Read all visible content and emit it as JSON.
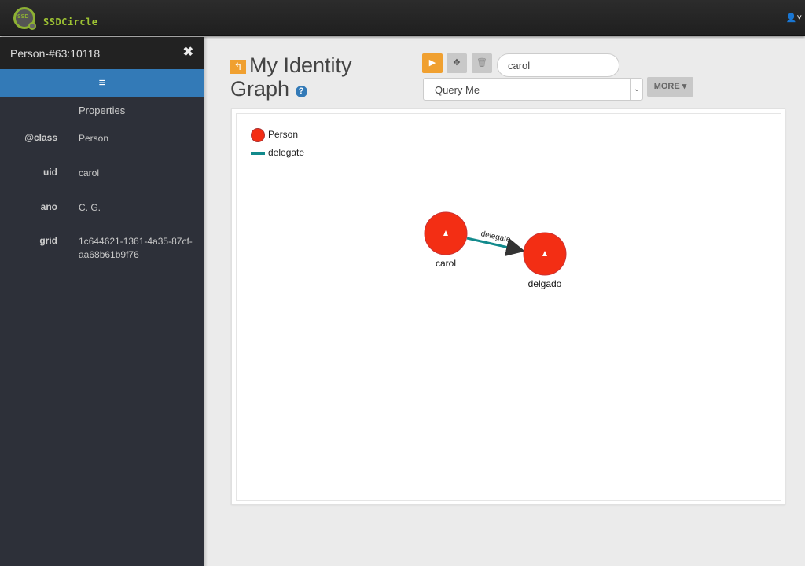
{
  "app": {
    "brand": "SSDCircle",
    "logo_text": "SSD",
    "user_icon": "user-icon"
  },
  "sidebar": {
    "title": "Person-#63:10118",
    "close_glyph": "✖",
    "toggle_glyph": "≡",
    "properties_title": "Properties",
    "properties": [
      {
        "key": "@class",
        "value": "Person"
      },
      {
        "key": "uid",
        "value": "carol"
      },
      {
        "key": "ano",
        "value": "C. G."
      },
      {
        "key": "grid",
        "value": "1c644621-1361-4a35-87cf-aa68b61b9f76"
      }
    ]
  },
  "header": {
    "title": "My Identity Graph",
    "back_glyph": "↰",
    "help_glyph": "?"
  },
  "toolbar": {
    "run_glyph": "▶",
    "fit_glyph": "✥",
    "delete_glyph": "🗑",
    "search_value": "carol",
    "query_selected": "Query Me",
    "more_label": "MORE ▾"
  },
  "graph": {
    "legend": [
      {
        "label": "Person",
        "type": "node",
        "color": "#f32e14"
      },
      {
        "label": "delegate",
        "type": "edge",
        "color": "#128a8c"
      }
    ],
    "nodes": [
      {
        "id": "carol",
        "label": "carol",
        "class": "Person"
      },
      {
        "id": "delgado",
        "label": "delgado",
        "class": "Person"
      }
    ],
    "edges": [
      {
        "from": "carol",
        "to": "delgado",
        "label": "delegate"
      }
    ]
  }
}
